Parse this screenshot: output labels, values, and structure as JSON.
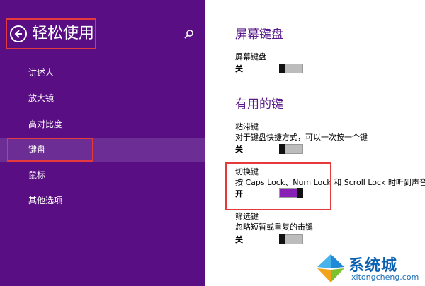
{
  "sidebar": {
    "title": "轻松使用",
    "items": [
      "讲述人",
      "放大镜",
      "高对比度",
      "键盘",
      "鼠标",
      "其他选项"
    ]
  },
  "main": {
    "section1_title": "屏幕键盘",
    "osk_label": "屏幕键盘",
    "osk_state": "关",
    "section2_title": "有用的键",
    "sticky_label": "粘滞键",
    "sticky_desc": "对于键盘快捷方式，可以一次按一个键",
    "sticky_state": "关",
    "toggle_label": "切换键",
    "toggle_desc": "按 Caps Lock、Num Lock 和 Scroll Lock 时听到声音",
    "toggle_state": "开",
    "filter_label": "筛选键",
    "filter_desc": "忽略短暂或重复的击键",
    "filter_state": "关"
  },
  "watermark": {
    "text": "系统城",
    "url": "xitongcheng.com"
  },
  "colors": {
    "sidebar": "#5a0e84",
    "accent": "#8a1fb5",
    "annotation": "#e6393c"
  },
  "icons": [
    "back-arrow-icon",
    "search-icon"
  ]
}
